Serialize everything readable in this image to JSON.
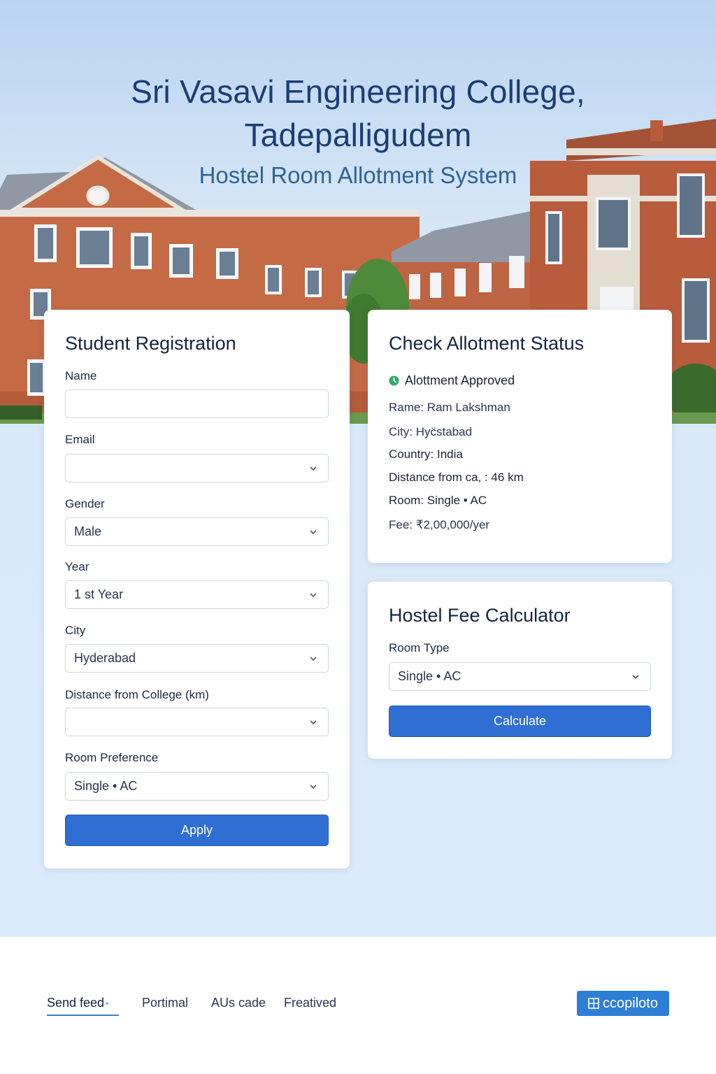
{
  "header": {
    "title_line1": "Sri Vasavi Engineering College,",
    "title_line2": "Tadepalligudem",
    "subtitle": "Hostel Room Allotment System"
  },
  "registration": {
    "heading": "Student Registration",
    "fields": {
      "name": {
        "label": "Name",
        "value": ""
      },
      "email": {
        "label": "Email",
        "value": ""
      },
      "gender": {
        "label": "Gender",
        "value": "Male"
      },
      "year": {
        "label": "Year",
        "value": "1 st Year"
      },
      "city": {
        "label": "City",
        "value": "Hyderabad"
      },
      "distance": {
        "label": "Distance from College (km)",
        "value": ""
      },
      "room": {
        "label": "Room Preference",
        "value": "Single • AC"
      }
    },
    "apply_label": "Apply"
  },
  "status": {
    "heading": "Check Allotment Status",
    "approved_text": "Alottment Approved",
    "approved_color": "#2fa86b",
    "lines": [
      "Rame: Ram Lakshman",
      "City: Hyc̈stabad",
      "Country: India",
      "Distance from ca, : 46 km",
      "Room: Single • AC",
      "Fee: ₹2,00,000/yer"
    ]
  },
  "fee_calculator": {
    "heading": "Hostel Fee Calculator",
    "room_type_label": "Room Type",
    "room_type_value": "Single • AC",
    "calculate_label": "Calculate"
  },
  "footer": {
    "links": [
      "Send feed",
      "Portimal",
      "AUs cade",
      "Freatived"
    ],
    "badge_label": "ccopiloto"
  },
  "colors": {
    "primary": "#2f6fd4",
    "title": "#1c3d73",
    "subtitle": "#2f6496",
    "page_bg": "#dbeafb"
  }
}
